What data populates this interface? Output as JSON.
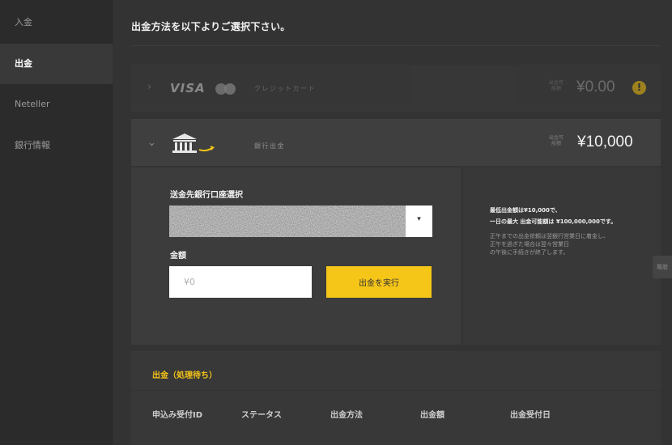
{
  "sidebar": {
    "items": [
      {
        "label": "入金",
        "active": false
      },
      {
        "label": "出金",
        "active": true
      },
      {
        "label": "Neteller",
        "active": false
      },
      {
        "label": "銀行情報",
        "active": false
      }
    ]
  },
  "header": {
    "title": "出金方法を以下よりご選択下さい。"
  },
  "methods": {
    "card": {
      "chevron": "›",
      "visa": "VISA",
      "label": "クレジットカード",
      "avail_label": "出金可能額",
      "amount": "¥0.00",
      "warning": "!"
    },
    "bank": {
      "chevron": "⌄",
      "label": "銀行出金",
      "avail_label": "出金可能額",
      "amount": "¥10,000"
    }
  },
  "form": {
    "bank_select_label": "送金先銀行口座選択",
    "select_arrow": "▾",
    "amount_label": "金額",
    "amount_placeholder": "¥0",
    "submit_label": "出金を実行"
  },
  "info": {
    "line1": "最低出金額は¥10,000で、",
    "line2": "一日の最大 出金可能額は ¥100,000,000です。",
    "note1": "正午までの出金依頼は翌銀行営業日に着金し、",
    "note2": "正午を過ぎた場合は翌々営業日",
    "note3": "の午後に手続きが終了します。"
  },
  "pending": {
    "title": "出金（処理待ち）",
    "columns": [
      "申込み受付ID",
      "ステータス",
      "出金方法",
      "出金額",
      "出金受付日"
    ]
  },
  "side_tab": {
    "label": "履歴"
  },
  "colors": {
    "accent": "#f5c518",
    "warning": "#f4c20d",
    "sidebar_active": "#393939"
  }
}
